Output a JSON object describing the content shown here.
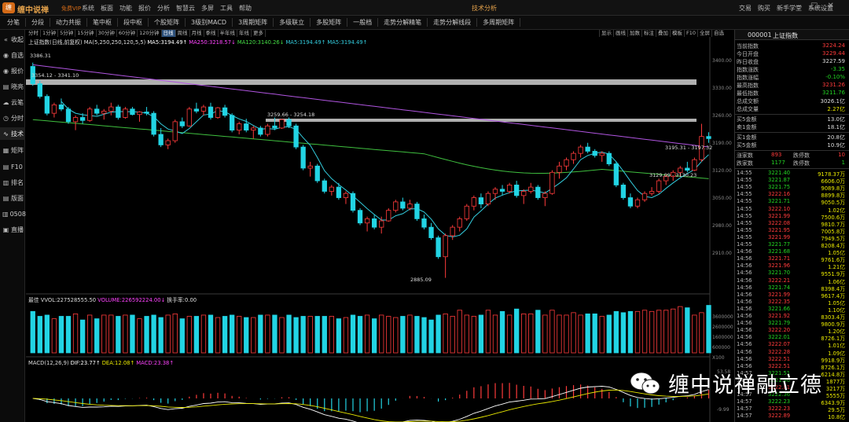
{
  "app": {
    "name": "缠中说禅",
    "vip": "免费VIP",
    "window_title": "技术分析",
    "menus": [
      "系统",
      "板面",
      "功能",
      "报价",
      "分析",
      "智慧云",
      "多屏",
      "工具",
      "帮助"
    ],
    "top_right": [
      "交易",
      "购买",
      "新手学堂",
      "系统设置"
    ]
  },
  "toolbar": [
    "分笔",
    "分段",
    "动力共振",
    "笔中枢",
    "段中枢",
    "个股矩阵",
    "3级别MACD",
    "3周期矩阵",
    "多级联立",
    "多股矩阵",
    "一般档",
    "走势分解精笔",
    "走势分解线段",
    "多周期矩阵"
  ],
  "sidebar": [
    {
      "icon": "collapse-icon",
      "glyph": "«",
      "label": "收起"
    },
    {
      "icon": "watchlist-icon",
      "glyph": "◉",
      "label": "自选"
    },
    {
      "icon": "quote-icon",
      "glyph": "◉",
      "label": "报价"
    },
    {
      "icon": "news-icon",
      "glyph": "▤",
      "label": "晓亮"
    },
    {
      "icon": "cloud-icon",
      "glyph": "☁",
      "label": "云笔"
    },
    {
      "icon": "timeshare-icon",
      "glyph": "◷",
      "label": "分时"
    },
    {
      "icon": "technical-icon",
      "glyph": "∿",
      "label": "技术"
    },
    {
      "icon": "matrix-icon",
      "glyph": "▦",
      "label": "矩阵"
    },
    {
      "icon": "f10-icon",
      "glyph": "▤",
      "label": "F10"
    },
    {
      "icon": "ranking-icon",
      "glyph": "▥",
      "label": "排名"
    },
    {
      "icon": "board-icon",
      "glyph": "▤",
      "label": "版面"
    },
    {
      "icon": "0508-icon",
      "glyph": "▥",
      "label": "0508"
    },
    {
      "icon": "live-icon",
      "glyph": "▣",
      "label": "直播"
    }
  ],
  "periods": [
    "分时",
    "1分钟",
    "5分钟",
    "15分钟",
    "30分钟",
    "60分钟",
    "120分钟",
    "日线",
    "周线",
    "月线",
    "季线",
    "半年线",
    "年线",
    "更多"
  ],
  "selected_period": "日线",
  "chart_tools": [
    "显示",
    "画线",
    "加数",
    "标注",
    "叠加",
    "模板",
    "F10",
    "全屏",
    "自选"
  ],
  "ma_legend": [
    {
      "text": "上证指数(日线,前复权) MA(5,250,250,120,5,5)",
      "color": "#dddddd"
    },
    {
      "text": "MA5:3194.49↑",
      "color": "#ffffff"
    },
    {
      "text": "MA250:3218.57↓",
      "color": "#ff44ff"
    },
    {
      "text": "MA120:3140.26↓",
      "color": "#44dd44"
    },
    {
      "text": "MA5:3194.49↑",
      "color": "#33ccdd"
    },
    {
      "text": "MA5:3194.49↑",
      "color": "#33ccdd"
    }
  ],
  "price_labels": {
    "high_left": "3386.31",
    "zone1": "3354.12 - 3341.10",
    "zone2": "3259.66 - 3254.18",
    "low": "2885.09",
    "right_a": "3195.31 - 3197.32",
    "right_b": "3129.09 - 3130.23"
  },
  "y_axis": [
    "3400.00",
    "3330.00",
    "3260.00",
    "3190.00",
    "3120.00",
    "3050.00",
    "2980.00",
    "2910.00"
  ],
  "vol_axis": [
    "3600000",
    "2600000",
    "1600000",
    "600000",
    "X100"
  ],
  "macd_axis": [
    "53.58",
    "-9.99"
  ],
  "vol_legend": [
    {
      "text": "最佳 VVOL:227528555.50",
      "color": "#dddddd"
    },
    {
      "text": "VOLUME:226592224.00↓",
      "color": "#ff44ff"
    },
    {
      "text": "换手率:0.00",
      "color": "#dddddd"
    }
  ],
  "macd_legend": [
    {
      "text": "MACD(12,26,9)",
      "color": "#dddddd"
    },
    {
      "text": "DIF:23.77↑",
      "color": "#ffffff"
    },
    {
      "text": "DEA:12.08↑",
      "color": "#e8e800"
    },
    {
      "text": "MACD:23.38↑",
      "color": "#ff44ff"
    }
  ],
  "candles": [
    [
      3386,
      3395,
      3340,
      3345
    ],
    [
      3345,
      3352,
      3310,
      3315
    ],
    [
      3315,
      3320,
      3270,
      3275
    ],
    [
      3275,
      3300,
      3265,
      3295
    ],
    [
      3295,
      3310,
      3280,
      3285
    ],
    [
      3285,
      3290,
      3250,
      3255
    ],
    [
      3255,
      3270,
      3235,
      3265
    ],
    [
      3265,
      3275,
      3250,
      3258
    ],
    [
      3258,
      3290,
      3255,
      3285
    ],
    [
      3285,
      3295,
      3270,
      3275
    ],
    [
      3275,
      3285,
      3260,
      3280
    ],
    [
      3280,
      3300,
      3270,
      3290
    ],
    [
      3290,
      3295,
      3260,
      3265
    ],
    [
      3265,
      3290,
      3262,
      3285
    ],
    [
      3285,
      3290,
      3270,
      3272
    ],
    [
      3272,
      3280,
      3255,
      3278
    ],
    [
      3278,
      3290,
      3270,
      3275
    ],
    [
      3275,
      3280,
      3220,
      3225
    ],
    [
      3225,
      3240,
      3195,
      3200
    ],
    [
      3200,
      3215,
      3190,
      3210
    ],
    [
      3210,
      3260,
      3205,
      3255
    ],
    [
      3255,
      3265,
      3240,
      3245
    ],
    [
      3245,
      3290,
      3243,
      3285
    ],
    [
      3285,
      3300,
      3275,
      3280
    ],
    [
      3280,
      3295,
      3270,
      3290
    ],
    [
      3290,
      3300,
      3260,
      3265
    ],
    [
      3265,
      3290,
      3262,
      3288
    ],
    [
      3288,
      3295,
      3265,
      3270
    ],
    [
      3270,
      3275,
      3230,
      3235
    ],
    [
      3235,
      3255,
      3225,
      3250
    ],
    [
      3250,
      3262,
      3230,
      3235
    ],
    [
      3235,
      3245,
      3215,
      3240
    ],
    [
      3240,
      3245,
      3220,
      3225
    ],
    [
      3225,
      3250,
      3220,
      3245
    ],
    [
      3245,
      3265,
      3235,
      3240
    ],
    [
      3240,
      3262,
      3238,
      3260
    ],
    [
      3260,
      3265,
      3240,
      3245
    ],
    [
      3245,
      3250,
      3190,
      3195
    ],
    [
      3195,
      3200,
      3140,
      3145
    ],
    [
      3145,
      3160,
      3125,
      3150
    ],
    [
      3150,
      3155,
      3110,
      3115
    ],
    [
      3115,
      3120,
      3085,
      3090
    ],
    [
      3090,
      3105,
      3080,
      3100
    ],
    [
      3100,
      3110,
      3070,
      3075
    ],
    [
      3075,
      3090,
      3060,
      3085
    ],
    [
      3085,
      3090,
      3040,
      3045
    ],
    [
      3045,
      3050,
      3010,
      3015
    ],
    [
      3015,
      3030,
      2995,
      3025
    ],
    [
      3025,
      3035,
      3000,
      3005
    ],
    [
      3005,
      3030,
      2990,
      3020
    ],
    [
      3020,
      3050,
      3018,
      3045
    ],
    [
      3045,
      3070,
      3040,
      3065
    ],
    [
      3065,
      3075,
      3045,
      3050
    ],
    [
      3050,
      3070,
      3045,
      3060
    ],
    [
      3060,
      3065,
      3020,
      3025
    ],
    [
      3025,
      3035,
      3000,
      3005
    ],
    [
      3005,
      3015,
      2975,
      2980
    ],
    [
      2980,
      2985,
      2930,
      2935
    ],
    [
      2935,
      2990,
      2885,
      2985
    ],
    [
      2985,
      3010,
      2975,
      3005
    ],
    [
      3005,
      3030,
      2995,
      3025
    ],
    [
      3025,
      3060,
      3020,
      3055
    ],
    [
      3055,
      3080,
      3045,
      3075
    ],
    [
      3075,
      3085,
      3050,
      3060
    ],
    [
      3060,
      3090,
      3055,
      3085
    ],
    [
      3085,
      3100,
      3070,
      3095
    ],
    [
      3095,
      3105,
      3080,
      3090
    ],
    [
      3090,
      3110,
      3085,
      3105
    ],
    [
      3105,
      3115,
      3075,
      3080
    ],
    [
      3080,
      3095,
      3060,
      3090
    ],
    [
      3090,
      3110,
      3085,
      3100
    ],
    [
      3100,
      3105,
      3070,
      3075
    ],
    [
      3075,
      3090,
      3055,
      3085
    ],
    [
      3085,
      3140,
      3082,
      3135
    ],
    [
      3135,
      3160,
      3120,
      3150
    ],
    [
      3150,
      3170,
      3140,
      3165
    ],
    [
      3165,
      3185,
      3155,
      3180
    ],
    [
      3180,
      3200,
      3170,
      3195
    ],
    [
      3195,
      3205,
      3180,
      3185
    ],
    [
      3185,
      3190,
      3170,
      3175
    ],
    [
      3175,
      3185,
      3160,
      3180
    ],
    [
      3180,
      3185,
      3150,
      3155
    ],
    [
      3155,
      3160,
      3100,
      3105
    ],
    [
      3105,
      3110,
      3070,
      3075
    ],
    [
      3075,
      3085,
      3050,
      3055
    ],
    [
      3055,
      3075,
      3050,
      3070
    ],
    [
      3070,
      3090,
      3065,
      3085
    ],
    [
      3085,
      3100,
      3080,
      3090
    ],
    [
      3090,
      3120,
      3085,
      3115
    ],
    [
      3115,
      3130,
      3105,
      3125
    ],
    [
      3125,
      3140,
      3115,
      3135
    ],
    [
      3135,
      3150,
      3125,
      3145
    ],
    [
      3145,
      3160,
      3135,
      3140
    ],
    [
      3140,
      3170,
      3138,
      3165
    ],
    [
      3165,
      3250,
      3160,
      3220
    ],
    [
      3220,
      3230,
      3205,
      3215
    ]
  ],
  "volumes": [
    34,
    30,
    31,
    28,
    30,
    30,
    32,
    27,
    31,
    28,
    31,
    31,
    30,
    31,
    31,
    28,
    30,
    31,
    29,
    31,
    32,
    28,
    30,
    30,
    31,
    31,
    29,
    30,
    31,
    30,
    29,
    29,
    31,
    31,
    31,
    29,
    31,
    29,
    30,
    30,
    30,
    30,
    30,
    28,
    29,
    31,
    30,
    31,
    28,
    31,
    30,
    29,
    30,
    31,
    30,
    29,
    27,
    31,
    32,
    30,
    35,
    31,
    30,
    31,
    35,
    31,
    34,
    31,
    36,
    32,
    32,
    35,
    31,
    35,
    31,
    31,
    33,
    31,
    32,
    32,
    30,
    31,
    34,
    33,
    34,
    34,
    35,
    34,
    35,
    35,
    36,
    38,
    37,
    31,
    33,
    39
  ],
  "quote_panel": {
    "code": "000001",
    "name": "上证指数",
    "rows": [
      {
        "k": "当前指数",
        "v": "3224.24",
        "c": "red"
      },
      {
        "k": "今日开盘",
        "v": "3229.44",
        "c": "red"
      },
      {
        "k": "昨日收盘",
        "v": "3227.59",
        "c": "white"
      },
      {
        "k": "指数涨跌",
        "v": "-3.35",
        "c": "green"
      },
      {
        "k": "指数涨幅",
        "v": "-0.10%",
        "c": "green"
      },
      {
        "k": "最高指数",
        "v": "3231.26",
        "c": "red"
      },
      {
        "k": "最低指数",
        "v": "3211.76",
        "c": "green"
      },
      {
        "k": "总成交额",
        "v": "3026.1亿",
        "c": "white"
      },
      {
        "k": "总成交量",
        "v": "2.27亿",
        "c": "yellow"
      }
    ],
    "rows2": [
      {
        "k": "买5金额",
        "v": "13.0亿",
        "c": "white"
      },
      {
        "k": "卖1金额",
        "v": "18.1亿",
        "c": "white"
      }
    ],
    "rows3": [
      {
        "k": "买1金额",
        "v": "20.8亿",
        "c": "white"
      },
      {
        "k": "买5金额",
        "v": "10.9亿",
        "c": "white"
      }
    ],
    "updown": [
      {
        "k1": "涨家数",
        "v1": "893",
        "c1": "red",
        "k2": "跌停数",
        "v2": "10",
        "c2": "red"
      },
      {
        "k1": "跌家数",
        "v1": "1177",
        "c1": "green",
        "k2": "跌停数",
        "v2": "1",
        "c2": "green"
      }
    ],
    "ticks": [
      [
        "14:55",
        "3221.40",
        "9178.37万",
        "green"
      ],
      [
        "14:55",
        "3221.87",
        "6606.0万",
        "green"
      ],
      [
        "14:55",
        "3221.75",
        "9089.8万",
        "green"
      ],
      [
        "14:55",
        "3222.16",
        "8899.8万",
        "red"
      ],
      [
        "14:55",
        "3221.71",
        "9050.5万",
        "green"
      ],
      [
        "14:55",
        "3222.10",
        "1.02亿",
        "red"
      ],
      [
        "14:55",
        "3221.99",
        "7500.6万",
        "red"
      ],
      [
        "14:55",
        "3222.08",
        "9810.7万",
        "red"
      ],
      [
        "14:55",
        "3221.95",
        "7005.8万",
        "red"
      ],
      [
        "14:55",
        "3221.99",
        "7949.5万",
        "red"
      ],
      [
        "14:55",
        "3221.77",
        "8208.4万",
        "green"
      ],
      [
        "14:56",
        "3221.68",
        "1.05亿",
        "green"
      ],
      [
        "14:56",
        "3221.71",
        "9761.6万",
        "red"
      ],
      [
        "14:56",
        "3221.96",
        "1.21亿",
        "red"
      ],
      [
        "14:56",
        "3221.70",
        "9551.9万",
        "green"
      ],
      [
        "14:56",
        "3222.21",
        "1.06亿",
        "red"
      ],
      [
        "14:56",
        "3221.74",
        "8398.4万",
        "green"
      ],
      [
        "14:56",
        "3221.99",
        "9617.4万",
        "red"
      ],
      [
        "14:56",
        "3222.35",
        "1.05亿",
        "red"
      ],
      [
        "14:56",
        "3221.66",
        "1.10亿",
        "green"
      ],
      [
        "14:56",
        "3221.92",
        "8303.4万",
        "red"
      ],
      [
        "14:56",
        "3221.79",
        "9800.9万",
        "green"
      ],
      [
        "14:56",
        "3222.20",
        "1.20亿",
        "red"
      ],
      [
        "14:56",
        "3222.01",
        "8726.1万",
        "green"
      ],
      [
        "14:56",
        "3222.07",
        "1.01亿",
        "red"
      ],
      [
        "14:56",
        "3222.28",
        "1.09亿",
        "red"
      ],
      [
        "14:56",
        "3222.51",
        "9918.9万",
        "red"
      ],
      [
        "14:56",
        "3222.51",
        "8726.1万",
        "red"
      ],
      [
        "14:57",
        "3221.51",
        "6214.8万",
        "green"
      ],
      [
        "14:57",
        "3221.46",
        "1877万",
        "green"
      ],
      [
        "14:57",
        "3222.81",
        "3217万",
        "red"
      ],
      [
        "14:57",
        "3222.36",
        "5555万",
        "green"
      ],
      [
        "14:57",
        "3222.23",
        "6343.9万",
        "green"
      ],
      [
        "14:57",
        "3222.23",
        "29.5万",
        "red"
      ],
      [
        "14:57",
        "3222.89",
        "10.8亿",
        "red"
      ]
    ]
  },
  "watermark": {
    "text": "缠中说禅融立德"
  },
  "colors": {
    "up": "#ff3b3b",
    "down": "#22d4e4",
    "ma5": "#33ccdd",
    "ma250": "#b055e0",
    "ma120": "#3fbf3f",
    "zone": "#cfcfcf"
  }
}
